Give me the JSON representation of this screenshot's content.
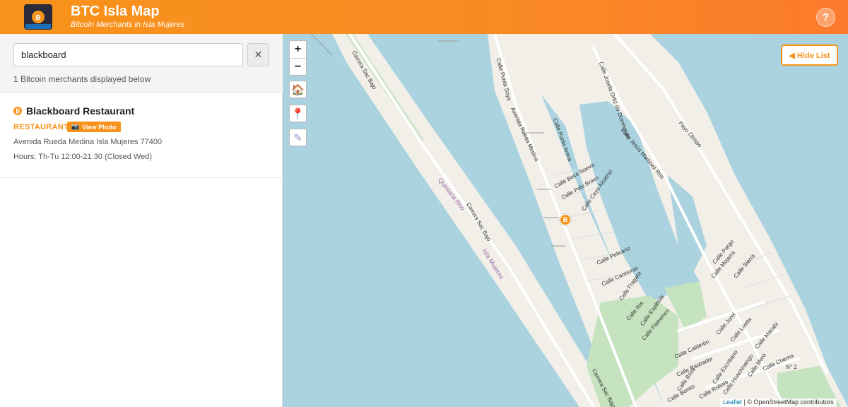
{
  "header": {
    "logo_text": "BTCISLA ISLA MUJERES",
    "title": "BTC Isla Map",
    "subtitle": "Bitcoin Merchants in Isla Mujeres",
    "help_label": "?"
  },
  "sidebar": {
    "search": {
      "value": "blackboard",
      "clear_label": "✕"
    },
    "count_text": "1 Bitcoin merchants displayed below",
    "merchants": [
      {
        "icon": "bitcoin-icon",
        "name": "Blackboard Restaurant",
        "category": "RESTAURANT",
        "photo_label": "View Photo",
        "address": "Avenida Rueda Medina Isla Mujeres 77400",
        "hours": "Hours: Th-Tu 12:00-21:30 (Closed Wed)"
      }
    ]
  },
  "map": {
    "zoom_in": "+",
    "zoom_out": "−",
    "home_icon": "🏠",
    "pin_icon": "📍",
    "edit_icon": "✎",
    "hide_list_label": "◀ Hide List",
    "marker_label": "B",
    "attribution": {
      "leaflet": "Leaflet",
      "separator": " | © ",
      "osm": "OpenStreetMap contributors"
    },
    "labels": {
      "carrera_sac_bajo_1": "Carrera Sac Bajo",
      "carrera_sac_bajo_2": "Carrera Sac Bajo",
      "carrera_sac_bajo_3": "Carrera Sac Bajo",
      "quintana_roo": "Quintana Roo",
      "isla_mujeres": "Isla Mujeres",
      "calle_punta_soya": "Calle Punta Soya",
      "av_rueda_medina": "Avenida Rueda Medina",
      "calle_punta_arena": "Calle Punta Arena",
      "calle_boca_nueva": "Calle Boca Nueva",
      "calle_palo_bravo": "Calle Palo Bravo",
      "calle_cayo_alcatraz": "Calle Cayo Alcatraz",
      "calle_pelicano": "Calle Pelicano",
      "calle_carmoran": "Calle Carmoran",
      "calle_fragata": "Calle Fragata",
      "calle_ibis": "Calle Ibis",
      "calle_espatula": "Calle Espátula",
      "calle_flamenco": "Calle Flamenco",
      "calle_calderon": "Calle Calderón",
      "calle_rastrador": "Calle Rastrador",
      "calle_josefa": "Calle Josefa Ortiz de Dominguez",
      "calle_jesus_martinez": "Calle Jesús Martinez Ros",
      "payo_obispo": "Payo Obispo",
      "calle_pargo": "Calle Pargo",
      "calle_mojarra": "Calle Mojarra",
      "calle_sierra": "Calle Sierra",
      "calle_jurel": "Calle Jurel",
      "calle_lizeta": "Calle Lizeta",
      "calle_macabi": "Calle Macabi",
      "calle_cherna": "Calle Cherna",
      "calle_mero": "Calle Mero",
      "calle_escribano": "Calle Escribano",
      "calle_huachinango": "Calle Huachinango",
      "calle_robalo": "Calle Robalo",
      "calle_brisa": "Calle Brisa",
      "calle_bonito": "Calle Bonito",
      "n2": "N° 2"
    }
  },
  "colors": {
    "brand_orange": "#f7931a",
    "water": "#aad3df",
    "land": "#f2efe9",
    "green": "#c5e3bf"
  }
}
